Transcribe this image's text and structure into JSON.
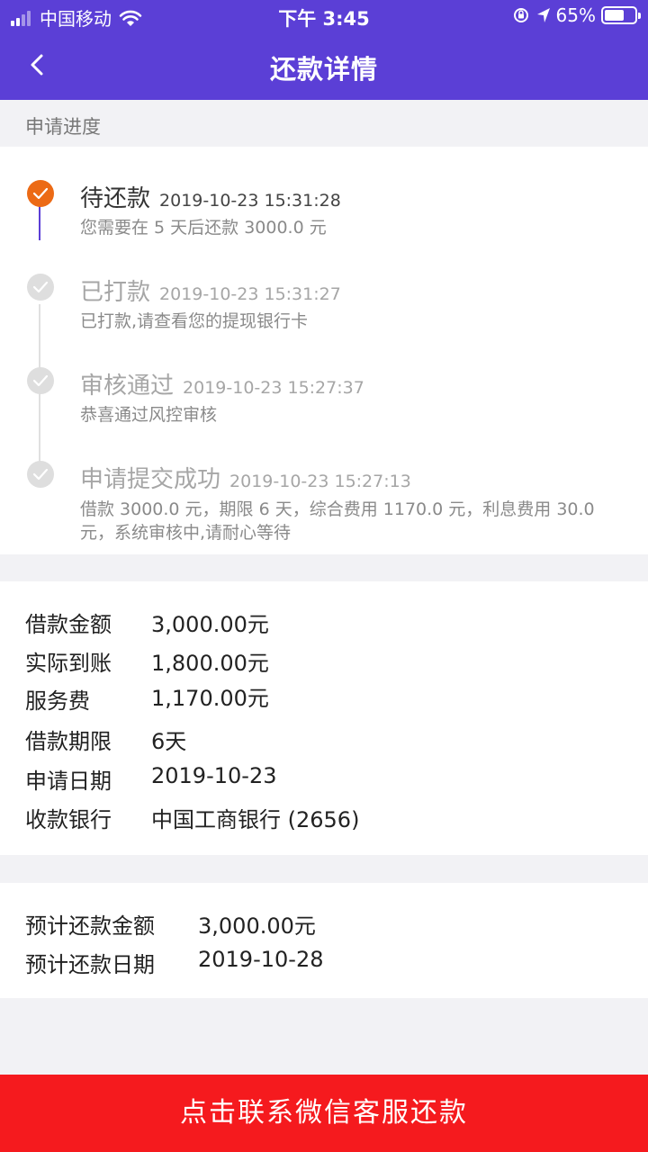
{
  "status_bar": {
    "carrier": "中国移动",
    "time": "下午 3:45",
    "battery_text": "65%",
    "battery_level": 0.65,
    "signal_bars": 2,
    "icons": [
      "signal-icon",
      "wifi-icon",
      "orientation-lock-icon",
      "location-arrow-icon",
      "battery-icon"
    ]
  },
  "nav": {
    "title": "还款详情",
    "back_icon": "chevron-left-icon"
  },
  "progress": {
    "section_label": "申请进度",
    "steps": [
      {
        "status": "待还款",
        "time": "2019-10-23 15:31:28",
        "desc": "您需要在 5 天后还款 3000.0 元",
        "state": "active"
      },
      {
        "status": "已打款",
        "time": "2019-10-23 15:31:27",
        "desc": "已打款,请查看您的提现银行卡",
        "state": "done"
      },
      {
        "status": "审核通过",
        "time": "2019-10-23 15:27:37",
        "desc": "恭喜通过风控审核",
        "state": "done"
      },
      {
        "status": "申请提交成功",
        "time": "2019-10-23 15:27:13",
        "desc": "借款 3000.0 元，期限 6 天，综合费用 1170.0 元，利息费用 30.0 元，系统审核中,请耐心等待",
        "state": "done"
      }
    ]
  },
  "loan_info": [
    {
      "label": "借款金额",
      "value": "3,000.00元"
    },
    {
      "label": "实际到账",
      "value": "1,800.00元"
    },
    {
      "label": "服务费",
      "value": "1,170.00元"
    },
    {
      "label": "借款期限",
      "value": "6天"
    },
    {
      "label": "申请日期",
      "value": "2019-10-23"
    },
    {
      "label": "收款银行",
      "value": "中国工商银行 (2656)"
    }
  ],
  "repay_info": [
    {
      "label": "预计还款金额",
      "value": "3,000.00元"
    },
    {
      "label": "预计还款日期",
      "value": "2019-10-28"
    }
  ],
  "action": {
    "label": "点击联系微信客服还款"
  },
  "colors": {
    "header": "#5b3fd6",
    "active_dot": "#ec6a15",
    "active_line": "#5b3fd6",
    "inactive_dot": "#dedede",
    "button": "#f51a1e"
  }
}
